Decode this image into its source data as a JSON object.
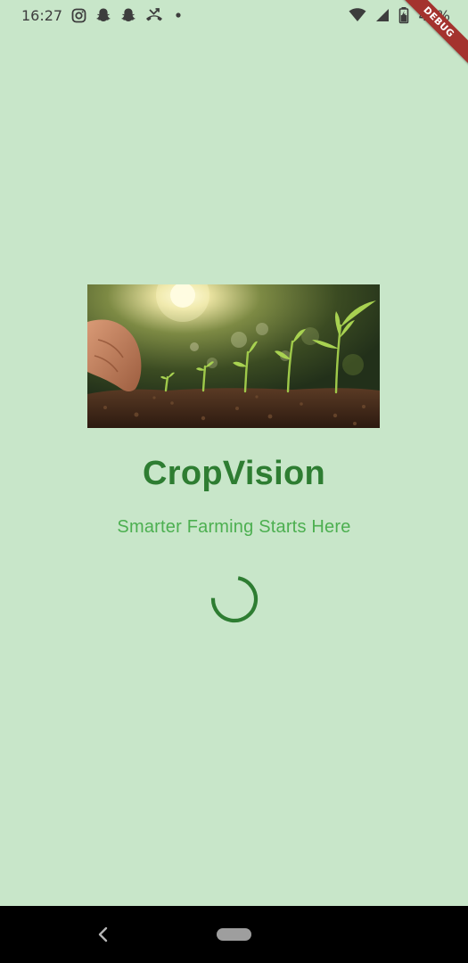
{
  "status_bar": {
    "time": "16:27",
    "battery": "45%",
    "left_icons": [
      "instagram-icon",
      "snapchat-icon",
      "snapchat-icon",
      "missed-call-icon",
      "dot-icon"
    ],
    "right_icons": [
      "wifi-icon",
      "signal-icon",
      "battery-icon"
    ]
  },
  "debug_banner": {
    "label": "DEBUG"
  },
  "splash": {
    "title": "CropVision",
    "subtitle": "Smarter Farming Starts Here"
  },
  "navigation": {
    "icons": [
      "back-icon",
      "home-pill"
    ]
  },
  "colors": {
    "background": "#c8e6c9",
    "title": "#2e7d32",
    "subtitle": "#4caf50",
    "spinner": "#2e7d32",
    "debug_ribbon": "#a4332e",
    "nav_bar": "#000000"
  }
}
